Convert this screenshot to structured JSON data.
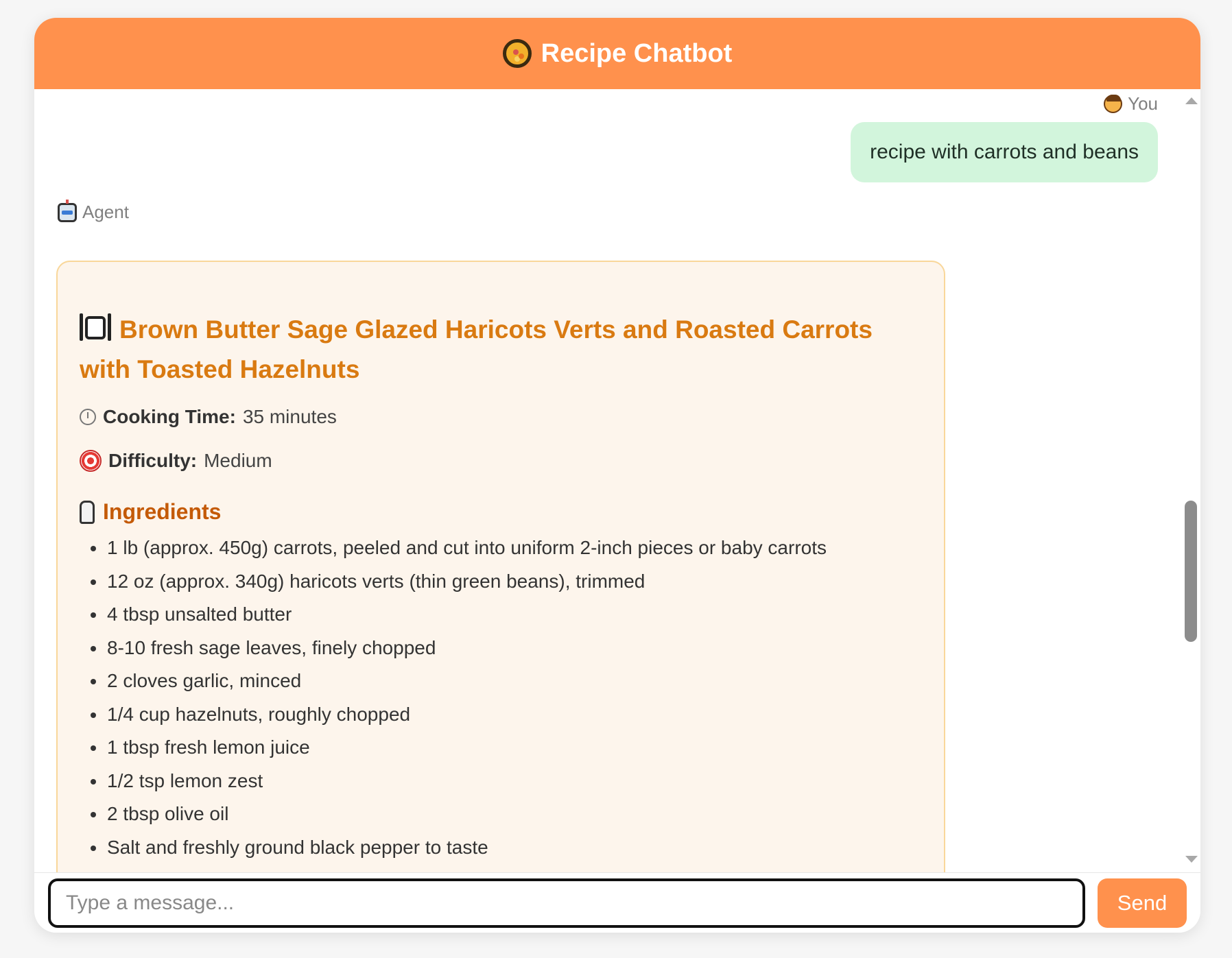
{
  "header": {
    "title": "Recipe Chatbot",
    "icon": "paella-pan-icon"
  },
  "chat": {
    "user_label": "You",
    "user_message": "recipe with carrots and beans",
    "agent_label": "Agent",
    "recipe": {
      "title": "Brown Butter Sage Glazed Haricots Verts and Roasted Carrots with Toasted Hazelnuts",
      "cooking_time_label": "Cooking Time:",
      "cooking_time_value": "35 minutes",
      "difficulty_label": "Difficulty:",
      "difficulty_value": "Medium",
      "ingredients_heading": "Ingredients",
      "ingredients": [
        "1 lb (approx. 450g) carrots, peeled and cut into uniform 2-inch pieces or baby carrots",
        "12 oz (approx. 340g) haricots verts (thin green beans), trimmed",
        "4 tbsp unsalted butter",
        "8-10 fresh sage leaves, finely chopped",
        "2 cloves garlic, minced",
        "1/4 cup hazelnuts, roughly chopped",
        "1 tbsp fresh lemon juice",
        "1/2 tsp lemon zest",
        "2 tbsp olive oil",
        "Salt and freshly ground black pepper to taste"
      ]
    }
  },
  "composer": {
    "placeholder": "Type a message...",
    "send_label": "Send"
  },
  "colors": {
    "accent": "#ff914d",
    "user_bubble": "#d2f5dc",
    "recipe_title": "#d97a11",
    "card_bg": "#fdf5ec"
  }
}
